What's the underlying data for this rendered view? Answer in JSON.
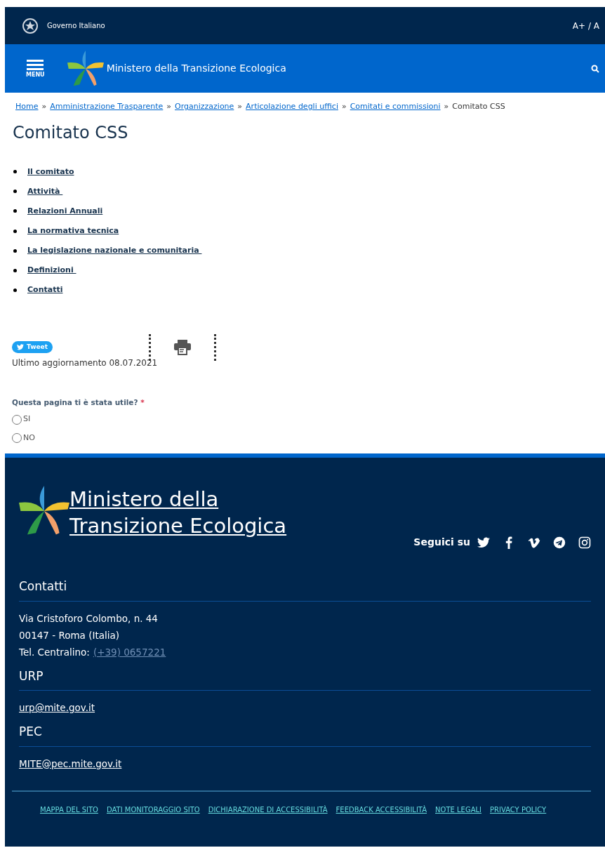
{
  "top_bar": {
    "label": "Governo Italiano",
    "font_size_control": "A+ / A"
  },
  "header": {
    "menu_label": "MENU",
    "title": "Ministero della Transizione Ecologica"
  },
  "breadcrumb": [
    "Home",
    "Amministrazione Trasparente",
    "Organizzazione",
    "Articolazione degli uffici",
    "Comitati e commissioni"
  ],
  "breadcrumb_separator": "»",
  "breadcrumb_current": "Comitato CSS",
  "page_title": "Comitato CSS",
  "links": [
    "Il comitato",
    "Attività ",
    "Relazioni Annuali",
    "La normativa tecnica",
    "La legislazione nazionale e comunitaria ",
    "Definizioni ",
    "Contatti"
  ],
  "tweet_button": "Tweet",
  "last_update": "Ultimo aggiornamento 08.07.2021",
  "feedback": {
    "question": "Questa pagina ti è stata utile?",
    "required_mark": "*",
    "options": [
      {
        "label": "SI",
        "selected": false
      },
      {
        "label": "NO",
        "selected": false
      }
    ]
  },
  "footer": {
    "title_line1": "Ministero della",
    "title_line2": "Transizione Ecologica",
    "follow_label": "Seguici su",
    "sections": [
      {
        "heading": "Contatti",
        "lines": [
          "Via Cristoforo Colombo, n. 44",
          "00147 - Roma (Italia)"
        ],
        "phone_label": "Tel. Centralino:",
        "phone": "(+39) 0657221"
      },
      {
        "heading": "URP",
        "link": "urp@mite.gov.it"
      },
      {
        "heading": "PEC",
        "link": "MITE@pec.mite.gov.it"
      }
    ],
    "bottom_links": [
      "MAPPA DEL SITO",
      "DATI MONITORAGGIO SITO",
      "DICHIARAZIONE DI ACCESSIBILITÀ",
      "FEEDBACK ACCESSIBILITÀ",
      "NOTE LEGALI",
      "PRIVACY POLICY"
    ]
  }
}
